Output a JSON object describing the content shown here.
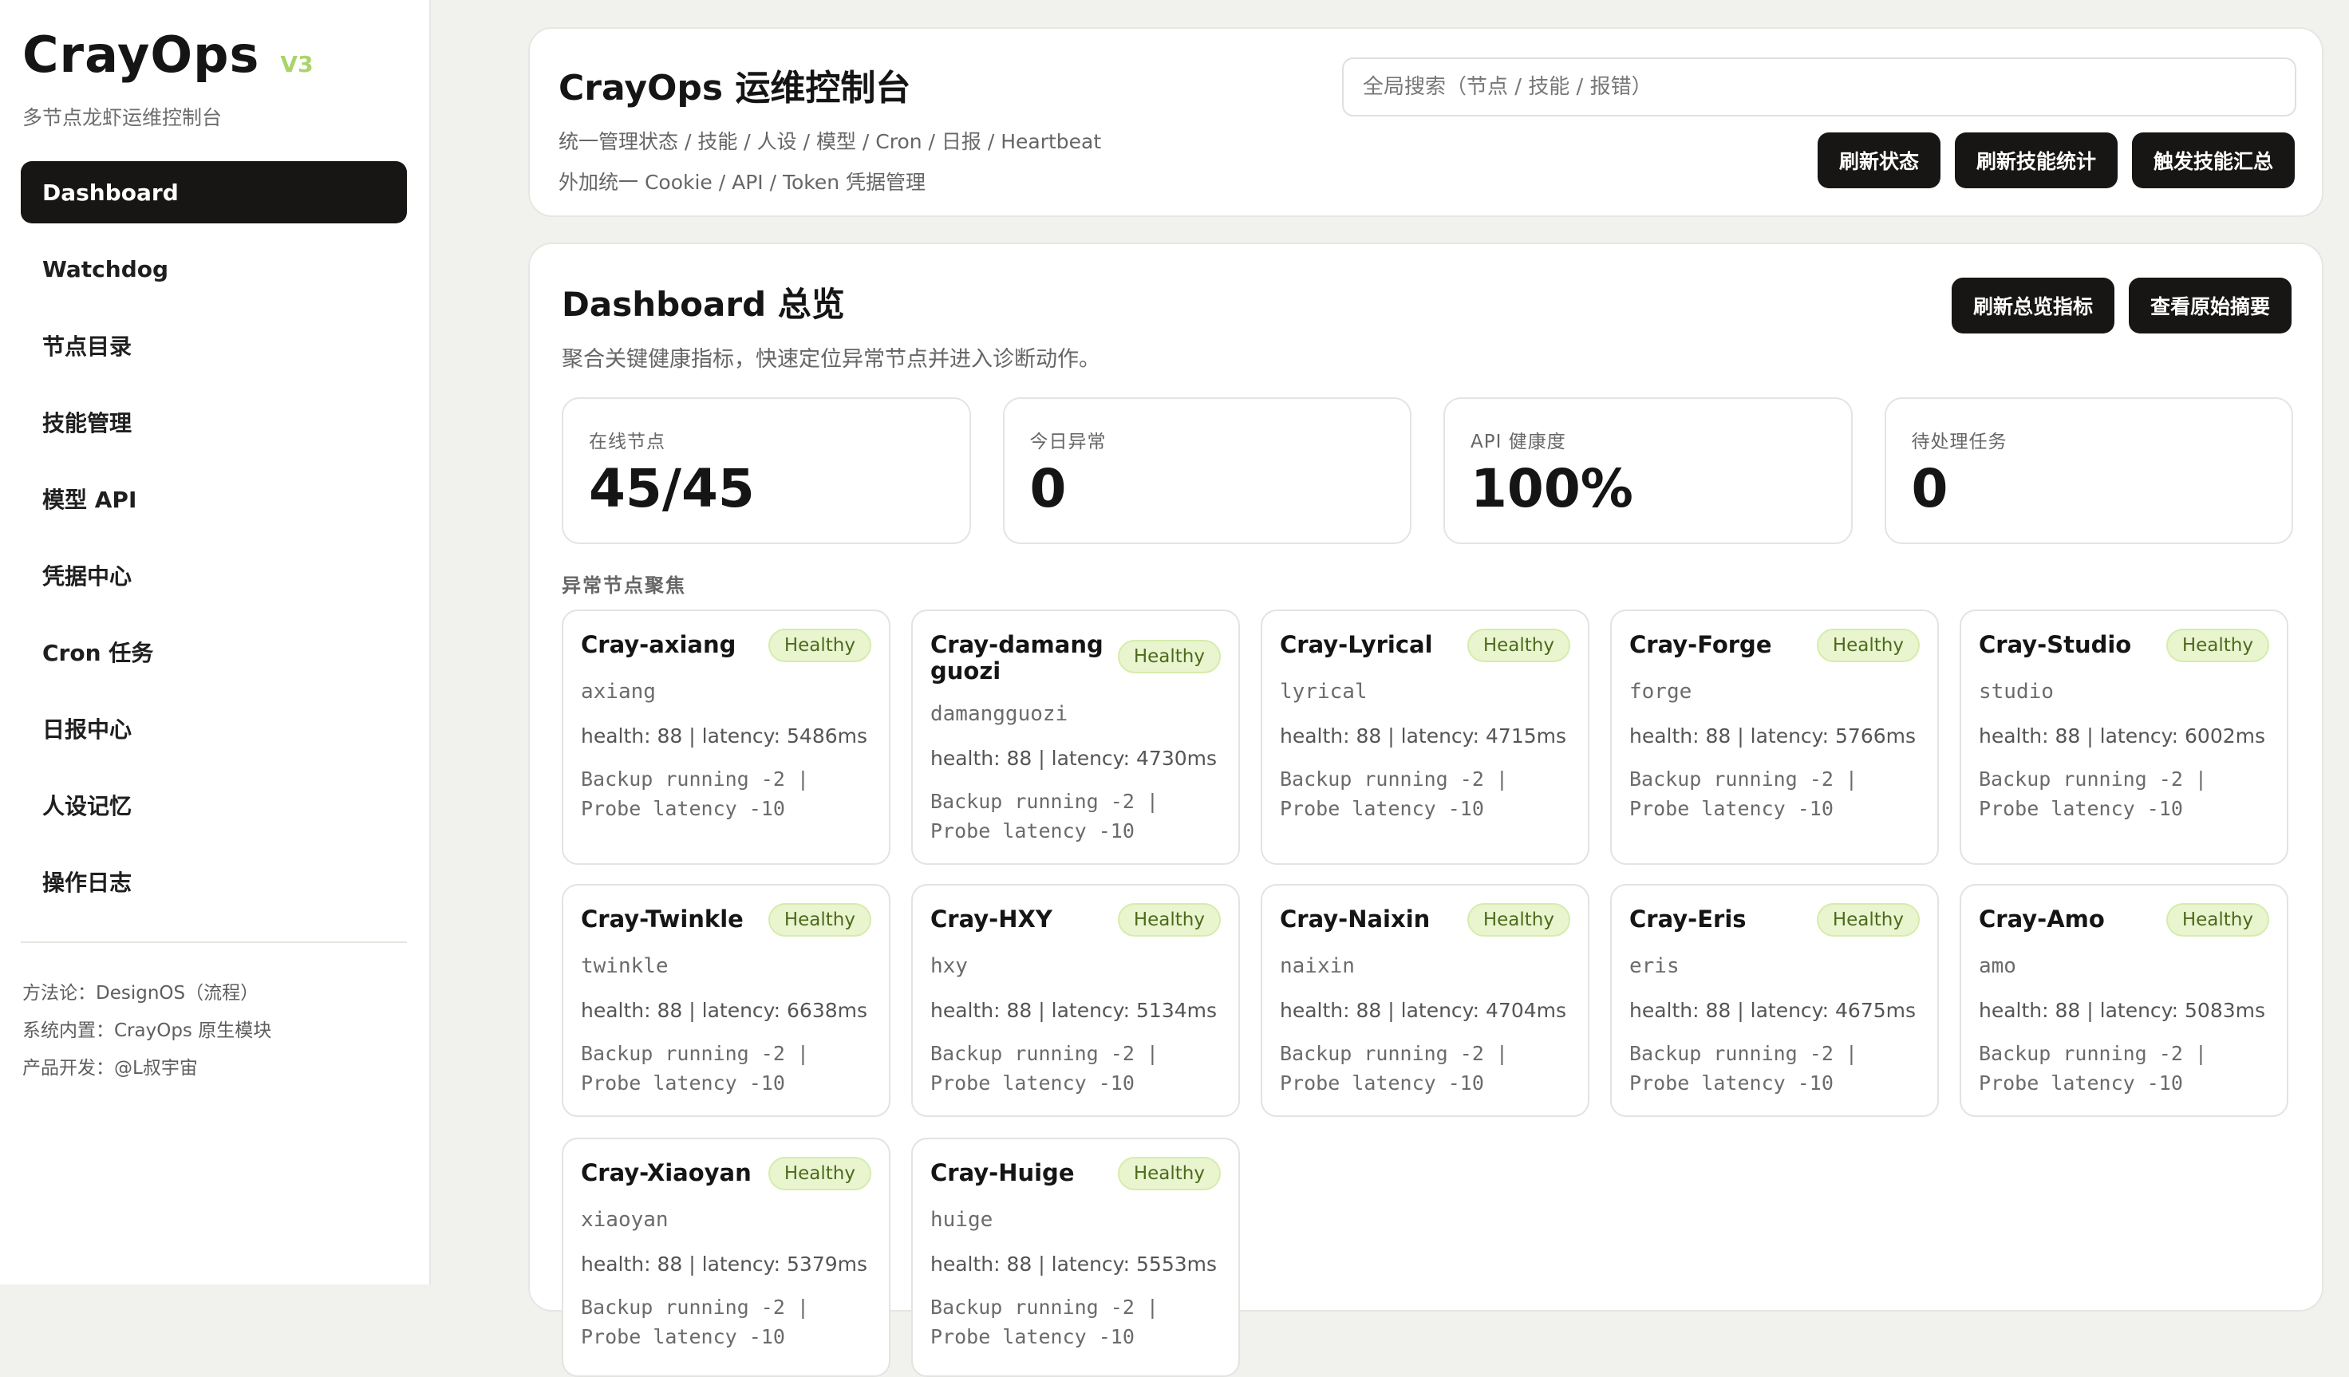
{
  "sidebar": {
    "brand": "CrayOps",
    "version": "V3",
    "subtitle": "多节点龙虾运维控制台",
    "items": [
      {
        "label": "Dashboard"
      },
      {
        "label": "Watchdog"
      },
      {
        "label": "节点目录"
      },
      {
        "label": "技能管理"
      },
      {
        "label": "模型 API"
      },
      {
        "label": "凭据中心"
      },
      {
        "label": "Cron 任务"
      },
      {
        "label": "日报中心"
      },
      {
        "label": "人设记忆"
      },
      {
        "label": "操作日志"
      }
    ],
    "footer": {
      "method": "方法论：DesignOS（流程）",
      "builtin": "系统内置：CrayOps 原生模块",
      "developer": "产品开发：@L叔宇宙"
    }
  },
  "header": {
    "title": "CrayOps 运维控制台",
    "desc_line1": "统一管理状态 / 技能 / 人设 / 模型 / Cron / 日报 / Heartbeat",
    "desc_line2": "外加统一 Cookie / API / Token 凭据管理",
    "search_placeholder": "全局搜索（节点 / 技能 / 报错）",
    "buttons": {
      "refresh_status": "刷新状态",
      "refresh_skill_stats": "刷新技能统计",
      "trigger_skill_summary": "触发技能汇总"
    }
  },
  "dashboard": {
    "title": "Dashboard 总览",
    "subtitle": "聚合关键健康指标，快速定位异常节点并进入诊断动作。",
    "buttons": {
      "refresh_overview": "刷新总览指标",
      "view_raw_summary": "查看原始摘要"
    },
    "stats": [
      {
        "label": "在线节点",
        "value": "45/45"
      },
      {
        "label": "今日异常",
        "value": "0"
      },
      {
        "label": "API 健康度",
        "value": "100%"
      },
      {
        "label": "待处理任务",
        "value": "0"
      }
    ],
    "section_label": "异常节点聚焦",
    "nodes": [
      {
        "name": "Cray-axiang",
        "status": "Healthy",
        "id": "axiang",
        "metric": "health: 88 | latency: 5486ms",
        "note": "Backup running -2 | Probe latency -10"
      },
      {
        "name": "Cray-damangguozi",
        "status": "Healthy",
        "id": "damangguozi",
        "metric": "health: 88 | latency: 4730ms",
        "note": "Backup running -2 | Probe latency -10"
      },
      {
        "name": "Cray-Lyrical",
        "status": "Healthy",
        "id": "lyrical",
        "metric": "health: 88 | latency: 4715ms",
        "note": "Backup running -2 | Probe latency -10"
      },
      {
        "name": "Cray-Forge",
        "status": "Healthy",
        "id": "forge",
        "metric": "health: 88 | latency: 5766ms",
        "note": "Backup running -2 | Probe latency -10"
      },
      {
        "name": "Cray-Studio",
        "status": "Healthy",
        "id": "studio",
        "metric": "health: 88 | latency: 6002ms",
        "note": "Backup running -2 | Probe latency -10"
      },
      {
        "name": "Cray-Twinkle",
        "status": "Healthy",
        "id": "twinkle",
        "metric": "health: 88 | latency: 6638ms",
        "note": "Backup running -2 | Probe latency -10"
      },
      {
        "name": "Cray-HXY",
        "status": "Healthy",
        "id": "hxy",
        "metric": "health: 88 | latency: 5134ms",
        "note": "Backup running -2 | Probe latency -10"
      },
      {
        "name": "Cray-Naixin",
        "status": "Healthy",
        "id": "naixin",
        "metric": "health: 88 | latency: 4704ms",
        "note": "Backup running -2 | Probe latency -10"
      },
      {
        "name": "Cray-Eris",
        "status": "Healthy",
        "id": "eris",
        "metric": "health: 88 | latency: 4675ms",
        "note": "Backup running -2 | Probe latency -10"
      },
      {
        "name": "Cray-Amo",
        "status": "Healthy",
        "id": "amo",
        "metric": "health: 88 | latency: 5083ms",
        "note": "Backup running -2 | Probe latency -10"
      },
      {
        "name": "Cray-Xiaoyan",
        "status": "Healthy",
        "id": "xiaoyan",
        "metric": "health: 88 | latency: 5379ms",
        "note": "Backup running -2 | Probe latency -10"
      },
      {
        "name": "Cray-Huige",
        "status": "Healthy",
        "id": "huige",
        "metric": "health: 88 | latency: 5553ms",
        "note": "Backup running -2 | Probe latency -10"
      }
    ]
  },
  "colors": {
    "primary_button": "#171615",
    "healthy_badge_bg": "#e9f5cf",
    "version_accent": "#a9d46a"
  }
}
